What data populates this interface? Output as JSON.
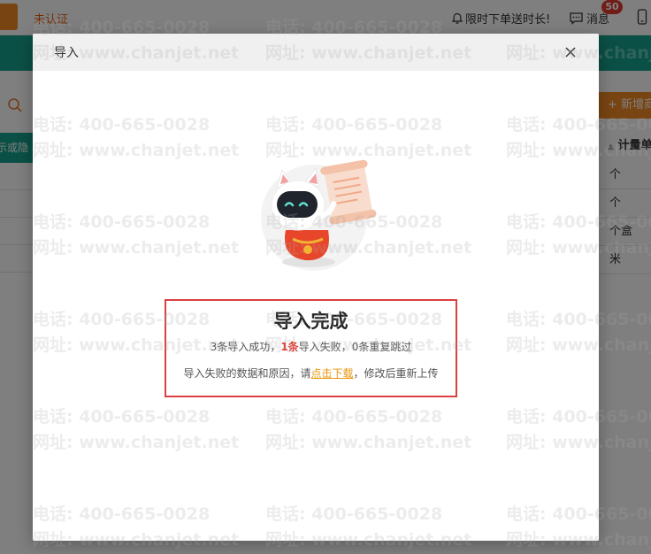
{
  "topbar": {
    "cert_status": "未认证",
    "promo_text": "限时下单送时长!",
    "messages_label": "消息",
    "messages_badge": "50"
  },
  "background": {
    "sidebar_tab": "示或隐",
    "add_button": "+ 新增商",
    "unit_header": "计量单",
    "unit_rows": [
      "个",
      "个",
      "个盒",
      "米"
    ]
  },
  "modal": {
    "title": "导入",
    "result_title": "导入完成",
    "success_text": "3条导入成功，",
    "fail_count": "1条",
    "fail_text": "导入失败，",
    "skipped_text": "0条重复跳过",
    "hint_prefix": "导入失败的数据和原因，请",
    "download_link": "点击下载",
    "hint_suffix": "，修改后重新上传"
  },
  "watermark": {
    "phone": "电话: 400-665-0028",
    "site": "网址: www.chanjet.net"
  },
  "colors": {
    "accent_orange": "#f08a24",
    "brand_teal": "#17a08c",
    "highlight_red": "#d94040",
    "link_orange": "#e8960c"
  },
  "icons": [
    "bell-icon",
    "chat-icon",
    "phone-icon",
    "search-icon",
    "sort-icon",
    "close-icon",
    "mascot-illustration"
  ]
}
